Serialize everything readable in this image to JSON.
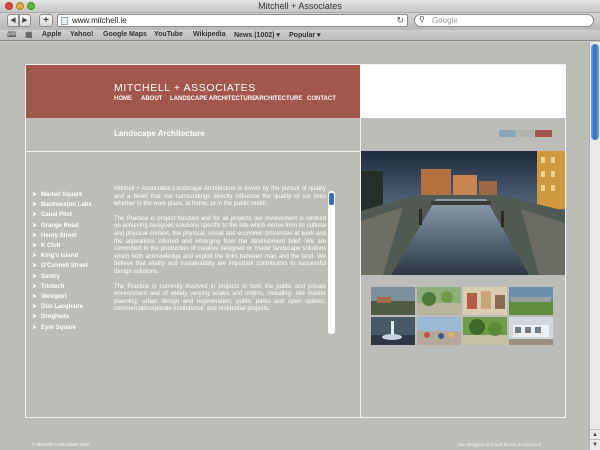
{
  "window": {
    "title": "Mitchell + Associates"
  },
  "toolbar": {
    "back_glyph": "◀",
    "forward_glyph": "▶",
    "add_glyph": "+",
    "url": "www.mitchell.ie",
    "reload_glyph": "↻",
    "search_placeholder": "Google",
    "search_glyph": "⚲"
  },
  "bookmarks": {
    "items": [
      "Apple",
      "Yahoo!",
      "Google Maps",
      "YouTube",
      "Wikipedia",
      "News (1002) ▾",
      "Popular ▾"
    ]
  },
  "site": {
    "brand": "MITCHELL + ASSOCIATES",
    "nav": [
      "HOME",
      "ABOUT",
      "LANDSCAPE ARCHITECTURE",
      "ARCHITECTURE",
      "CONTACT"
    ],
    "section_title": "Landscape Architecture",
    "swatch_colors": [
      "#8aa4b8",
      "#b3b3ad",
      "#a1574c"
    ],
    "projects": [
      "Market Square",
      "Backweston Labs",
      "Canal Pilot",
      "Grange Road",
      "Henry Street",
      "K Club",
      "King's Island",
      "O'Connell Street",
      "Santry",
      "Trintech",
      "Westport",
      "Dún Laoghaire",
      "Drogheda",
      "Eyre Square"
    ],
    "project_arrow": "➤",
    "paragraphs": [
      "Mitchell + Associates Landscape Architecture is driven by the pursuit of quality and a belief that our surroundings directly influence the quality of our lives whether in the work place, at home, or in the public realm.",
      "The Practice is project focused and for all projects our involvement is centred on achieving designed solutions specific to the site which derive from its cultural and physical context, the physical, social and economic processes at work and the aspirations inferred and emerging from the development brief. We are committed to the production of creative designed or 'made' landscape solutions which both acknowledge and exploit the links between man and the land. We believe that vitality and sustainability are important contributors to successful design solutions.",
      "The Practice is currently involved in projects in both the public and private environment and of widely varying scales and origins, including: site master planning; urban design and regeneration; public parks and open spaces; commercial/corporate institutional; and residential projects."
    ],
    "footer_left": "© Mitchell + Associates 2005",
    "footer_right": "site designed and built by our productions"
  }
}
